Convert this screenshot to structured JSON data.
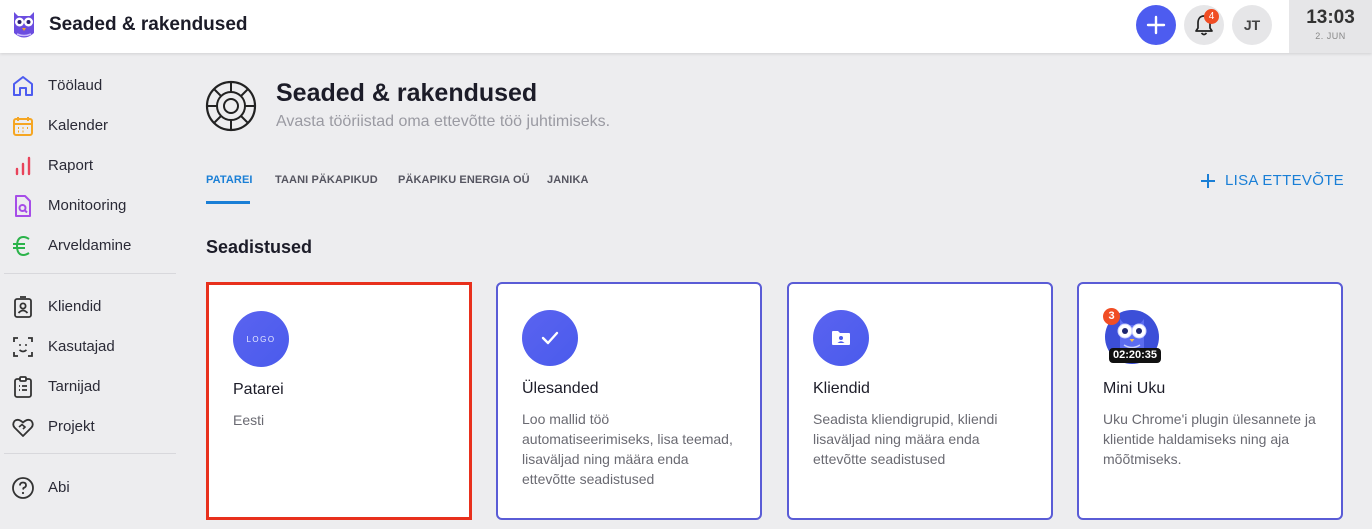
{
  "app": {
    "title": "Seaded & rakendused"
  },
  "topbar": {
    "notifications_count": "4",
    "avatar_initials": "JT",
    "clock_time": "13:03",
    "clock_date": "2. JUN"
  },
  "sidebar": {
    "items": [
      {
        "label": "Töölaud",
        "icon": "home-icon",
        "color": "#4d5cf0"
      },
      {
        "label": "Kalender",
        "icon": "calendar-icon",
        "color": "#f5a623"
      },
      {
        "label": "Raport",
        "icon": "bar-chart-icon",
        "color": "#e8435a"
      },
      {
        "label": "Monitooring",
        "icon": "monitor-document-icon",
        "color": "#a64de8"
      },
      {
        "label": "Arveldamine",
        "icon": "euro-icon",
        "color": "#2bb34a"
      },
      {
        "label": "Kliendid",
        "icon": "client-badge-icon",
        "color": "#333"
      },
      {
        "label": "Kasutajad",
        "icon": "face-scan-icon",
        "color": "#333"
      },
      {
        "label": "Tarnijad",
        "icon": "clipboard-list-icon",
        "color": "#333"
      },
      {
        "label": "Projekt",
        "icon": "handshake-heart-icon",
        "color": "#333"
      },
      {
        "label": "Abi",
        "icon": "help-circle-icon",
        "color": "#333"
      }
    ]
  },
  "page": {
    "title": "Seaded & rakendused",
    "subtitle": "Avasta tööriistad oma ettevõtte töö juhtimiseks."
  },
  "tabs": [
    {
      "label": "PATAREI",
      "active": true
    },
    {
      "label": "TAANI PÄKAPIKUD",
      "active": false
    },
    {
      "label": "PÄKAPIKU ENERGIA OÜ",
      "active": false
    },
    {
      "label": "JANIKA",
      "active": false
    }
  ],
  "add_company_label": "LISA ETTEVÕTE",
  "section_title": "Seadistused",
  "cards": [
    {
      "title": "Patarei",
      "desc": "Eesti",
      "logo_text": "LOGO",
      "icon": "company-logo-placeholder"
    },
    {
      "title": "Ülesanded",
      "desc": "Loo mallid töö automatiseerimiseks, lisa teemad, lisaväljad ning määra enda ettevõtte seadistused",
      "icon": "check-icon"
    },
    {
      "title": "Kliendid",
      "desc": "Seadista kliendigrupid, kliendi lisaväljad ning määra enda ettevõtte seadistused",
      "icon": "folder-person-icon"
    },
    {
      "title": "Mini Uku",
      "desc": "Uku Chrome'i plugin ülesannete ja klientide haldamiseks ning aja mõõtmiseks.",
      "icon": "owl-icon",
      "badge_count": "3",
      "timer": "02:20:35"
    }
  ],
  "colors": {
    "accent": "#4d5cf0",
    "tab_active": "#1a7fd6",
    "badge": "#f04d24",
    "selection": "#e8301c"
  }
}
